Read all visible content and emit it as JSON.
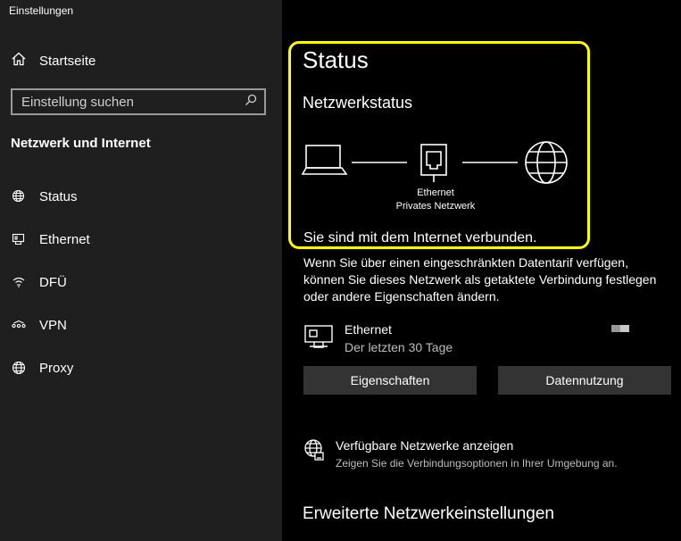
{
  "window": {
    "title": "Einstellungen"
  },
  "sidebar": {
    "home_label": "Startseite",
    "search_placeholder": "Einstellung suchen",
    "section_title": "Netzwerk und Internet",
    "items": [
      {
        "label": "Status",
        "icon": "globe-network-icon"
      },
      {
        "label": "Ethernet",
        "icon": "ethernet-icon"
      },
      {
        "label": "DFÜ",
        "icon": "dialup-icon"
      },
      {
        "label": "VPN",
        "icon": "vpn-icon"
      },
      {
        "label": "Proxy",
        "icon": "globe-icon"
      }
    ]
  },
  "main": {
    "page_title": "Status",
    "network_status_title": "Netzwerkstatus",
    "diagram": {
      "adapter_name": "Ethernet",
      "network_type": "Privates Netzwerk"
    },
    "connected_text": "Sie sind mit dem Internet verbunden.",
    "info_text": "Wenn Sie über einen eingeschränkten Datentarif verfügen, können Sie dieses Netzwerk als getaktete Verbindung festlegen oder andere Eigenschaften ändern.",
    "connection": {
      "name": "Ethernet",
      "subtitle": "Der letzten 30 Tage"
    },
    "buttons": {
      "properties": "Eigenschaften",
      "data_usage": "Datennutzung"
    },
    "available_networks": {
      "title": "Verfügbare Netzwerke anzeigen",
      "subtitle": "Zeigen Sie die Verbindungsoptionen in Ihrer Umgebung an."
    },
    "advanced_title": "Erweiterte Netzwerkeinstellungen"
  },
  "colors": {
    "highlight": "#ffff00",
    "sidebar_bg": "#1f1f1f",
    "main_bg": "#000000",
    "button_bg": "#333333"
  }
}
